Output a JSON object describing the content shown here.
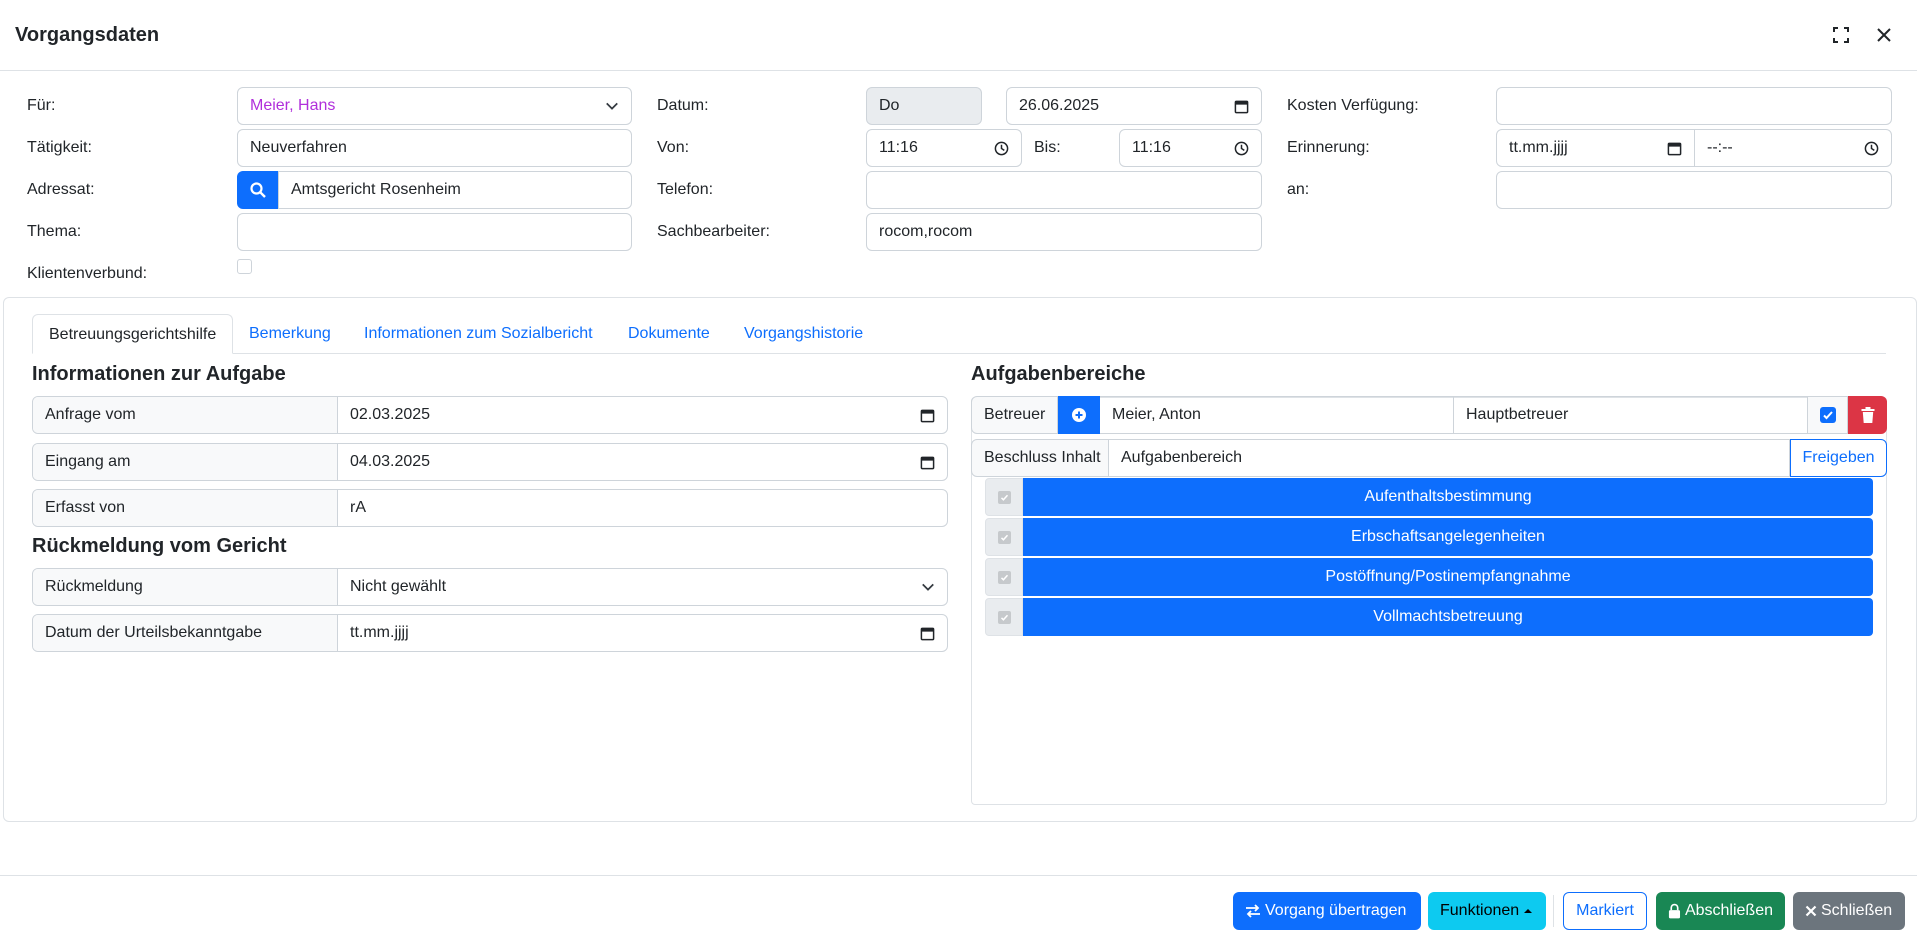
{
  "modal": {
    "title": "Vorgangsdaten"
  },
  "form": {
    "fuer_label": "Für:",
    "fuer_value": "Meier, Hans",
    "taetigkeit_label": "Tätigkeit:",
    "taetigkeit_value": "Neuverfahren",
    "adressat_label": "Adressat:",
    "adressat_value": "Amtsgericht Rosenheim",
    "thema_label": "Thema:",
    "thema_value": "",
    "klientenverbund_label": "Klientenverbund:",
    "datum_label": "Datum:",
    "datum_day": "Do",
    "datum_value": "26.06.2025",
    "von_label": "Von:",
    "von_value": "11:16",
    "bis_label": "Bis:",
    "bis_value": "11:16",
    "telefon_label": "Telefon:",
    "telefon_value": "",
    "sachbearbeiter_label": "Sachbearbeiter:",
    "sachbearbeiter_value": "rocom,rocom",
    "kosten_label": "Kosten Verfügung:",
    "kosten_value": "",
    "erinnerung_label": "Erinnerung:",
    "erinnerung_date": "tt.mm.jjjj",
    "erinnerung_time": "--:--",
    "an_label": "an:",
    "an_value": ""
  },
  "tabs": [
    {
      "label": "Betreuungsgerichtshilfe",
      "active": true
    },
    {
      "label": "Bemerkung"
    },
    {
      "label": "Informationen zum Sozialbericht"
    },
    {
      "label": "Dokumente"
    },
    {
      "label": "Vorgangshistorie"
    }
  ],
  "aufgabe": {
    "heading": "Informationen zur Aufgabe",
    "anfrage_label": "Anfrage vom",
    "anfrage_value": "02.03.2025",
    "eingang_label": "Eingang am",
    "eingang_value": "04.03.2025",
    "erfasst_label": "Erfasst von",
    "erfasst_value": "rA"
  },
  "rueckmeldung": {
    "heading": "Rückmeldung vom Gericht",
    "rueckmeldung_label": "Rückmeldung",
    "rueckmeldung_value": "Nicht gewählt",
    "datum_label": "Datum der Urteilsbekanntgabe",
    "datum_value": "tt.mm.jjjj"
  },
  "aufgabenbereiche": {
    "heading": "Aufgabenbereiche",
    "betreuer_label": "Betreuer",
    "betreuer_name": "Meier, Anton",
    "betreuer_role": "Hauptbetreuer",
    "beschluss_label": "Beschluss Inhalt",
    "aufgabenbereich_label": "Aufgabenbereich",
    "freigeben_label": "Freigeben",
    "items": [
      "Aufenthaltsbestimmung",
      "Erbschaftsangelegenheiten",
      "Postöffnung/Postinempfangnahme",
      "Vollmachtsbetreuung"
    ]
  },
  "footer": {
    "uebertragen": "Vorgang übertragen",
    "funktionen": "Funktionen",
    "markiert": "Markiert",
    "abschliessen": "Abschließen",
    "schliessen": "Schließen"
  },
  "colors": {
    "primary": "#0d6efd",
    "info": "#0dcaf0",
    "success": "#198754",
    "danger": "#dc3545",
    "secondary": "#6c757d",
    "fuer_text": "#b02fdb"
  }
}
